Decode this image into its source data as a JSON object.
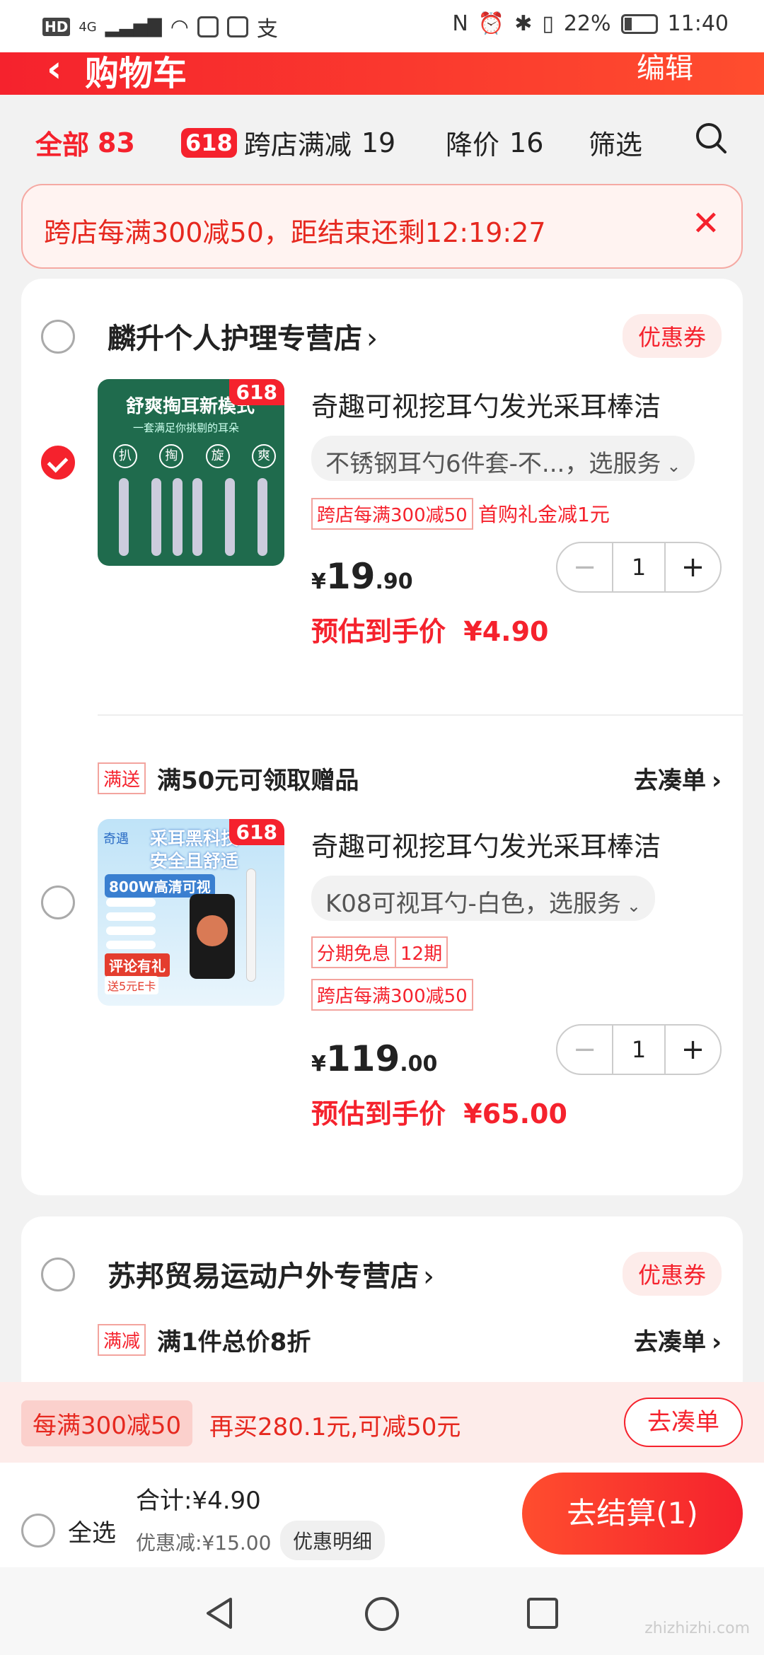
{
  "status_bar": {
    "network": "4G",
    "battery": "22%",
    "time": "11:40"
  },
  "header": {
    "title": "购物车",
    "edit": "编辑"
  },
  "filters": [
    {
      "label": "全部",
      "count": "83"
    },
    {
      "badge": "618",
      "label": "跨店满减",
      "count": "19"
    },
    {
      "label": "降价",
      "count": "16"
    },
    {
      "label": "筛选"
    }
  ],
  "banner": {
    "text": "跨店每满300减50，距结束还剩12:19:27"
  },
  "stores": [
    {
      "name": "麟升个人护理专营店",
      "coupon": "优惠券",
      "items": [
        {
          "selected": true,
          "badge": "618",
          "thumb_heading": "舒爽掏耳新模式",
          "thumb_sub": "一套满足你挑剔的耳朵",
          "thumb_labels": [
            "扒",
            "掏",
            "旋",
            "爽"
          ],
          "title": "奇趣可视挖耳勺发光采耳棒洁",
          "sku": "不锈钢耳勺6件套-不...，选服务",
          "tags": [
            "跨店每满300减50"
          ],
          "extra": "首购礼金减1元",
          "price_int": "19",
          "price_dec": ".90",
          "est_label": "预估到手价",
          "est_price": "¥4.90",
          "qty": "1"
        },
        {
          "selected": false,
          "badge": "618",
          "promo_tag": "满送",
          "promo_text": "满50元可领取赠品",
          "promo_go": "去凑单",
          "thumb_brand": "奇遇",
          "thumb_heading": "采耳黑科技",
          "thumb_heading2": "安全且舒适",
          "thumb_mid": "800W高清可视",
          "thumb_bottom": "评论有礼",
          "thumb_bottom2": "送5元E卡",
          "title": "奇趣可视挖耳勺发光采耳棒洁",
          "sku": "K08可视耳勺-白色，选服务",
          "tag1": "分期免息",
          "tag1b": "12期",
          "tag2": "跨店每满300减50",
          "price_int": "119",
          "price_dec": ".00",
          "est_label": "预估到手价",
          "est_price": "¥65.00",
          "qty": "1"
        }
      ]
    },
    {
      "name": "苏邦贸易运动户外专营店",
      "coupon": "优惠券",
      "promo_tag": "满减",
      "promo_text": "满1件总价8折",
      "promo_go": "去凑单"
    }
  ],
  "promo_bar": {
    "label": "每满300减50",
    "message": "再买280.1元,可减50元",
    "button": "去凑单"
  },
  "checkout": {
    "select_all": "全选",
    "total": "合计:¥4.90",
    "discount": "优惠减:¥15.00",
    "detail": "优惠明细",
    "pay": "去结算(1)"
  },
  "watermark": "zhizhizhi.com"
}
